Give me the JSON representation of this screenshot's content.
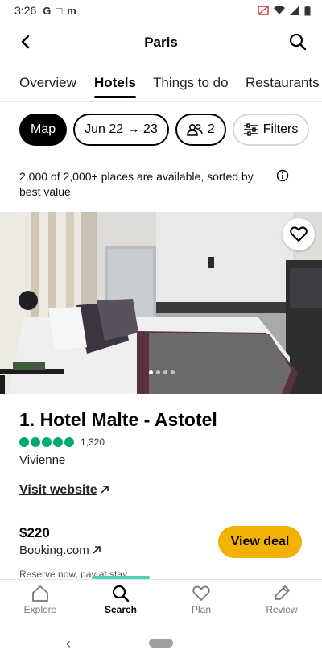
{
  "status_bar": {
    "time": "3:26",
    "notifications": [
      "G",
      "□",
      "m"
    ]
  },
  "header": {
    "title": "Paris",
    "back_icon": "arrow-left-icon",
    "search_icon": "search-icon"
  },
  "tabs": [
    {
      "label": "Overview",
      "active": false
    },
    {
      "label": "Hotels",
      "active": true
    },
    {
      "label": "Things to do",
      "active": false
    },
    {
      "label": "Restaurants",
      "active": false
    }
  ],
  "filters": {
    "map_label": "Map",
    "dates_label": "Jun 22 → 23",
    "guests_label": "2",
    "filters_label": "Filters"
  },
  "summary": {
    "text": "2,000 of 2,000+ places are available, sorted by ",
    "sort_label": "best value"
  },
  "listing": {
    "name": "1. Hotel Malte - Astotel",
    "rating_bubbles": 5,
    "review_count": "1,320",
    "neighborhood": "Vivienne",
    "website_label": "Visit website",
    "price": "$220",
    "provider": "Booking.com",
    "reserve_note": "Reserve now, pay at stay",
    "deal_label": "View deal",
    "photo_dots": 4
  },
  "bottom_nav": [
    {
      "label": "Explore",
      "icon": "home-icon",
      "active": false
    },
    {
      "label": "Search",
      "icon": "search-icon",
      "active": true
    },
    {
      "label": "Plan",
      "icon": "heart-icon",
      "active": false
    },
    {
      "label": "Review",
      "icon": "pencil-icon",
      "active": false
    }
  ],
  "colors": {
    "accent_green": "#00aa6c",
    "deal_yellow": "#f2b203",
    "nav_indicator": "#4fd1b3"
  }
}
